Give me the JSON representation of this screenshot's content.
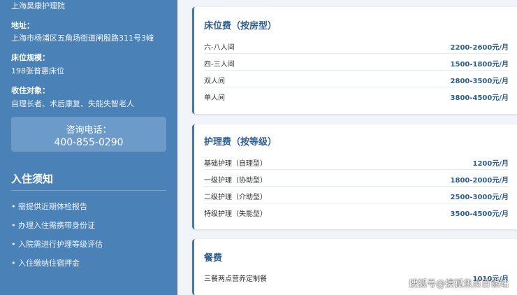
{
  "sidebar": {
    "name": "上海昊康护理院",
    "address_label": "地址：",
    "address_value": "上海市杨浦区五角场街道闸殷路311号3幢",
    "beds_label": "床位规模：",
    "beds_value": "198张普惠床位",
    "target_label": "收住对象：",
    "target_value": "自理长者、术后康复、失能失智老人",
    "phone_label": "咨询电话：",
    "phone_number": "400-855-0290",
    "notice_title": "入住须知",
    "notices": [
      "• 需提供近期体检报告",
      "• 办理入住需携带身份证",
      "• 入院需进行护理等级评估",
      "• 入住缴纳住宿押金"
    ]
  },
  "cards": [
    {
      "title": "床位费（按房型）",
      "rows": [
        {
          "name": "六-八人间",
          "price": "2200-2600元/月"
        },
        {
          "name": "四-三人间",
          "price": "1500-1800元/月"
        },
        {
          "name": "双人间",
          "price": "2800-3500元/月"
        },
        {
          "name": "单人间",
          "price": "3800-4500元/月"
        }
      ]
    },
    {
      "title": "护理费（按等级）",
      "rows": [
        {
          "name": "基础护理（自理型）",
          "price": "1200元/月"
        },
        {
          "name": "一级护理（协助型）",
          "price": "1800-2000元/月"
        },
        {
          "name": "二级护理（介助型）",
          "price": "2500-3000元/月"
        },
        {
          "name": "特级护理（失能型）",
          "price": "3500-4500元/月"
        }
      ]
    },
    {
      "title": "餐费",
      "rows": [
        {
          "name": "三餐两点营养定制餐",
          "price": "1010元/月"
        }
      ]
    }
  ],
  "watermark": "搜狐号@搜狐焦点百银站",
  "colors": {
    "sidebar": "#4a82b8",
    "accent": "#2e5d8c",
    "background": "#f1f5fa"
  }
}
